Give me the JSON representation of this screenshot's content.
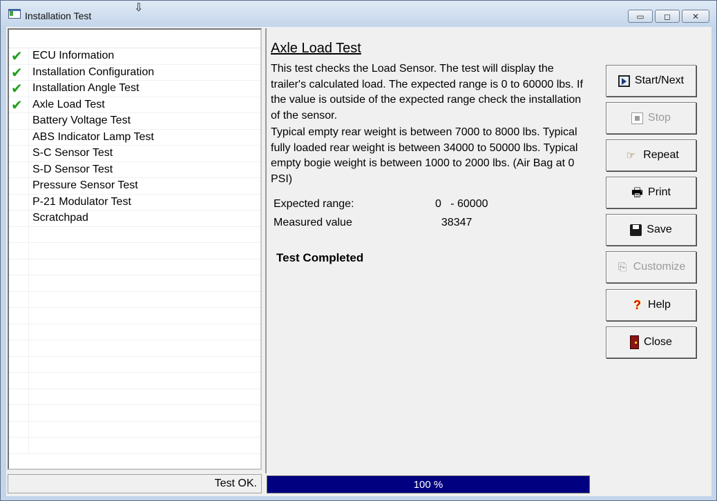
{
  "window": {
    "title": "Installation Test",
    "controls": {
      "minimize": "▭",
      "maximize": "◻",
      "close": "✕"
    }
  },
  "cursor_glyph": "⇩",
  "test_list": [
    {
      "label": "ECU Information",
      "passed": true
    },
    {
      "label": "Installation Configuration",
      "passed": true
    },
    {
      "label": "Installation Angle Test",
      "passed": true
    },
    {
      "label": "Axle Load Test",
      "passed": true
    },
    {
      "label": "Battery Voltage Test",
      "passed": false
    },
    {
      "label": "ABS Indicator Lamp Test",
      "passed": false
    },
    {
      "label": "S-C Sensor Test",
      "passed": false
    },
    {
      "label": "S-D Sensor Test",
      "passed": false
    },
    {
      "label": "Pressure Sensor Test",
      "passed": false
    },
    {
      "label": "P-21 Modulator Test",
      "passed": false
    },
    {
      "label": "Scratchpad",
      "passed": false
    }
  ],
  "check_glyph": "✔",
  "detail": {
    "heading": "Axle Load Test",
    "paragraph1": "This test checks the Load Sensor. The test will display the trailer's calculated load. The expected range is 0 to 60000 lbs. If the value is outside of the expected range check the installation of the sensor.",
    "paragraph2": "Typical empty rear weight is between 7000 to 8000 lbs. Typical fully loaded rear weight is between 34000 to 50000 lbs. Typical empty bogie weight is between 1000 to 2000 lbs.  (Air Bag at 0 PSI)",
    "expected_label": "Expected range:",
    "expected_value": "0   - 60000",
    "measured_label": "Measured value",
    "measured_value": "  38347",
    "status": "Test Completed"
  },
  "buttons": {
    "start_next": "Start/Next",
    "stop": "Stop",
    "repeat": "Repeat",
    "print": "Print",
    "save": "Save",
    "customize": "Customize",
    "help": "Help",
    "close": "Close"
  },
  "icons": {
    "repeat": "☞",
    "print": "🖶",
    "customize": "⎘",
    "help": "?"
  },
  "status_bar": {
    "message": "Test OK.",
    "progress_percent": 100,
    "progress_label": "100 %"
  },
  "colors": {
    "progress": "#000080",
    "check": "#1ea01e"
  }
}
